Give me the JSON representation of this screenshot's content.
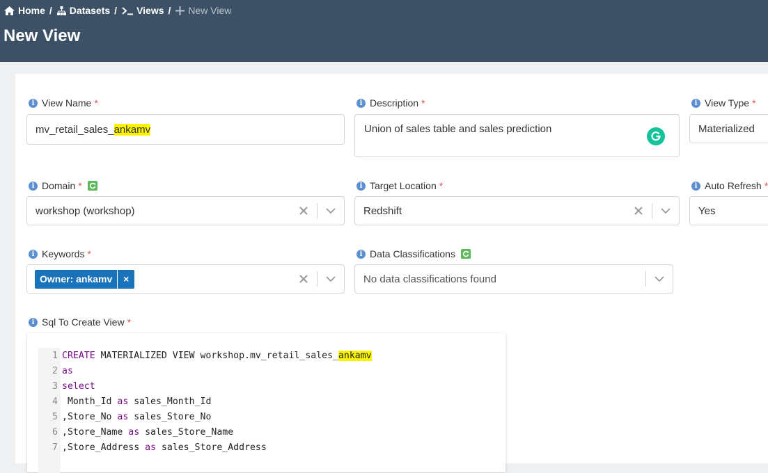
{
  "breadcrumb": {
    "home": "Home",
    "datasets": "Datasets",
    "views": "Views",
    "current": "New View"
  },
  "page_title": "New View",
  "form": {
    "view_name": {
      "label": "View Name",
      "value_prefix": "mv_retail_sales_",
      "value_highlight": "ankamv"
    },
    "description": {
      "label": "Description",
      "value": "Union of sales table and sales prediction"
    },
    "view_type": {
      "label": "View Type",
      "value": "Materialized"
    },
    "domain": {
      "label": "Domain",
      "value": "workshop (workshop)"
    },
    "target_location": {
      "label": "Target Location",
      "value": "Redshift"
    },
    "auto_refresh": {
      "label": "Auto Refresh",
      "value": "Yes"
    },
    "keywords": {
      "label": "Keywords",
      "tag": "Owner: ankamv",
      "tag_remove": "×"
    },
    "data_classifications": {
      "label": "Data Classifications",
      "placeholder": "No data classifications found"
    },
    "sql": {
      "label": "Sql To Create View"
    }
  },
  "sql_lines": [
    {
      "n": "1",
      "kw": "CREATE",
      "rest": " MATERIALIZED VIEW workshop.mv_retail_sales_",
      "hl": "ankamv",
      "kw2": "",
      "rest2": ""
    },
    {
      "n": "2",
      "kw": "as",
      "rest": "",
      "hl": "",
      "kw2": "",
      "rest2": ""
    },
    {
      "n": "3",
      "kw": "select",
      "rest": "",
      "hl": "",
      "kw2": "",
      "rest2": ""
    },
    {
      "n": "4",
      "kw": "",
      "rest": " Month_Id ",
      "hl": "",
      "kw2": "as",
      "rest2": " sales_Month_Id"
    },
    {
      "n": "5",
      "kw": "",
      "rest": ",Store_No ",
      "hl": "",
      "kw2": "as",
      "rest2": " sales_Store_No"
    },
    {
      "n": "6",
      "kw": "",
      "rest": ",Store_Name ",
      "hl": "",
      "kw2": "as",
      "rest2": " sales_Store_Name"
    },
    {
      "n": "7",
      "kw": "",
      "rest": ",Store_Address ",
      "hl": "",
      "kw2": "as",
      "rest2": " sales_Store_Address"
    }
  ],
  "colors": {
    "header_bg": "#3d5166",
    "tag_bg": "#1a73b8",
    "keyword": "#7a0d8b",
    "highlight": "#fdf500",
    "required": "#d9534f"
  }
}
